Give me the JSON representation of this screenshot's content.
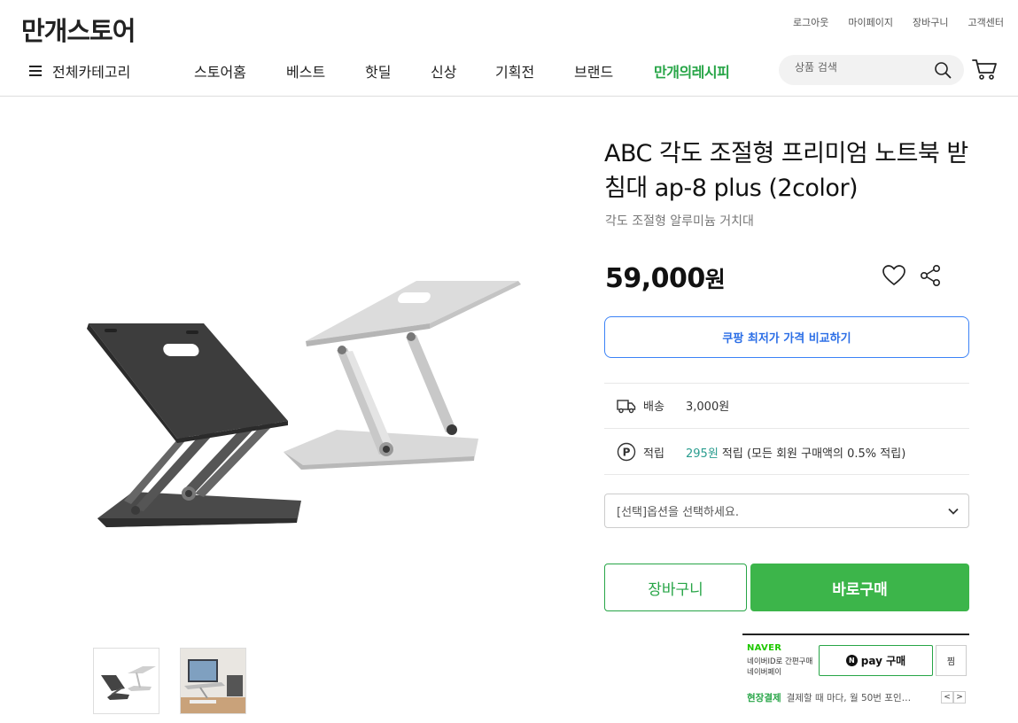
{
  "header": {
    "logo": "만개스토어",
    "util_links": [
      "로그아웃",
      "마이페이지",
      "장바구니",
      "고객센터"
    ],
    "category_label": "전체카테고리",
    "nav": [
      "스토어홈",
      "베스트",
      "핫딜",
      "신상",
      "기획전",
      "브랜드"
    ],
    "nav_special": "만개의레시피",
    "search_placeholder": "상품 검색"
  },
  "product": {
    "title": "ABC 각도 조절형 프리미엄 노트북 받침대 ap-8 plus (2color)",
    "subtitle": "각도 조절형 알루미늄 거치대",
    "price": "59,000",
    "currency": "원",
    "compare_label": "쿠팡 최저가 가격 비교하기",
    "shipping_label": "배송",
    "shipping_value": "3,000원",
    "points_label": "적립",
    "points_value": "295원",
    "points_text": " 적립 (모든 회원 구매액의 0.5% 적립)",
    "option_placeholder": "[선택]옵션을 선택하세요.",
    "cart_label": "장바구니",
    "buy_label": "바로구매"
  },
  "npay": {
    "brand": "NAVER",
    "desc_line1": "네이버ID로 간편구매",
    "desc_line2": "네이버페이",
    "pay_label": "pay 구매",
    "n_mark": "N",
    "zzim_label": "찜",
    "onsite_title": "현장결제",
    "onsite_text": "결제할 때 마다, 월 50번 포인…",
    "prev": "<",
    "next": ">"
  },
  "colors": {
    "green": "#3cb54a",
    "blue": "#3b82f6",
    "points": "#2a9d8f"
  }
}
